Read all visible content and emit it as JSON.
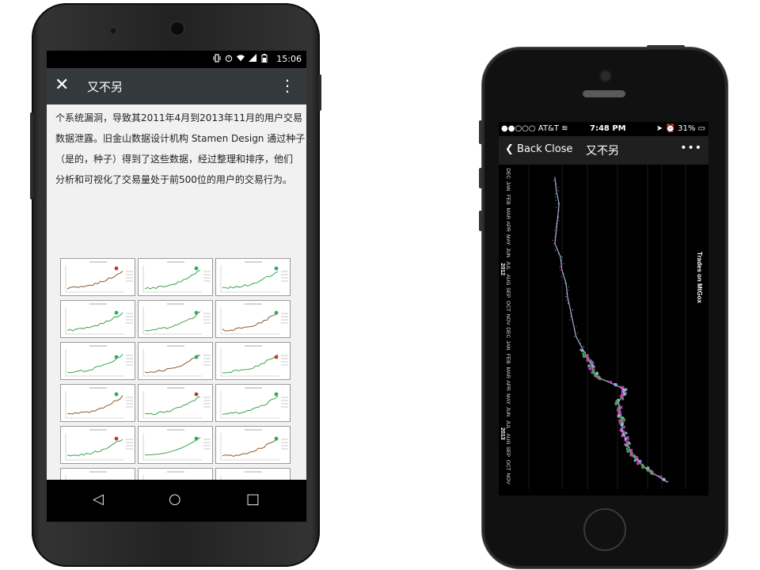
{
  "android": {
    "status": {
      "time": "15:06"
    },
    "appbar": {
      "close_glyph": "✕",
      "title": "又不另",
      "more_glyph": "⋮"
    },
    "article_lines": [
      "个系统漏洞，导致其2011年4月到2013年11月的用户交易",
      "数据泄露。旧金山数据设计机构 Stamen Design 通过种子",
      "（是的，种子）得到了这些数据，经过整理和排序，他们",
      "分析和可视化了交易量处于前500位的用户的交易行为。"
    ],
    "nav": {
      "back_glyph": "◁",
      "home_glyph": "○",
      "recent_glyph": "□"
    }
  },
  "iphone": {
    "status": {
      "carrier": "●●○○○ AT&T",
      "time": "7:48 PM",
      "battery": "31%"
    },
    "nav": {
      "back_label": "Back",
      "close_label": "Close",
      "title": "又不另",
      "more_glyph": "•••"
    }
  },
  "chart_data": {
    "type": "line",
    "title": "Trades on MtGox",
    "orientation": "rotated-90",
    "x": {
      "months": [
        "DEC",
        "JAN",
        "FEB",
        "MAR",
        "APR",
        "MAY",
        "JUN",
        "JUL",
        "AUG",
        "SEP",
        "OCT",
        "NOV",
        "DEC",
        "JAN",
        "FEB",
        "MAR",
        "APR",
        "MAY",
        "JUN",
        "JUL",
        "AUG",
        "SEP",
        "OCT",
        "NOV"
      ],
      "year_labels": [
        "2012",
        "2013"
      ]
    },
    "series": [
      {
        "values": [
          0.05,
          0.06,
          0.08,
          0.07,
          0.06,
          0.05,
          0.09,
          0.1,
          0.13,
          0.14,
          0.16,
          0.18,
          0.2,
          0.25,
          0.3,
          0.34,
          0.55,
          0.5,
          0.52,
          0.53,
          0.56,
          0.6,
          0.7,
          0.85
        ]
      }
    ],
    "colors": {
      "pink": "#d048c8",
      "cyan": "#8fd8e0",
      "green": "#4caf50",
      "trace": "#9fb8d0"
    }
  }
}
